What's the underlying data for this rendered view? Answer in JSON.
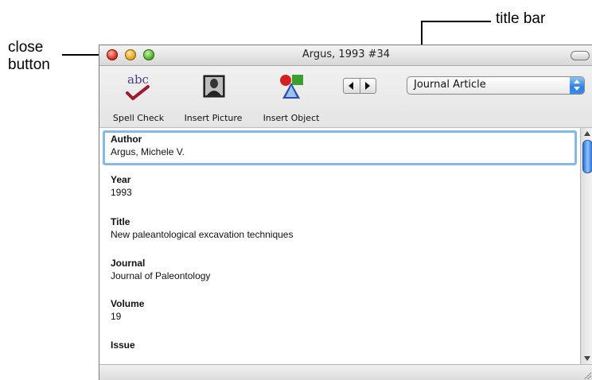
{
  "annotations": {
    "title_bar": "title bar",
    "close_button_line1": "close",
    "close_button_line2": "button"
  },
  "window": {
    "title": "Argus, 1993 #34"
  },
  "toolbar": {
    "spell_check_label": "Spell Check",
    "spell_check_icon_text": "abc",
    "insert_picture_label": "Insert Picture",
    "insert_object_label": "Insert Object",
    "reference_type": "Journal Article"
  },
  "fields": [
    {
      "label": "Author",
      "value": "Argus, Michele V."
    },
    {
      "label": "Year",
      "value": "1993"
    },
    {
      "label": "Title",
      "value": "New paleantological excavation techniques"
    },
    {
      "label": "Journal",
      "value": "Journal of Paleontology"
    },
    {
      "label": "Volume",
      "value": "19"
    },
    {
      "label": "Issue",
      "value": ""
    }
  ],
  "icons": {
    "close": "close-icon",
    "minimize": "minimize-icon",
    "zoom": "zoom-icon",
    "spell_check": "spell-check-icon",
    "insert_picture": "insert-picture-icon",
    "insert_object": "insert-object-icon"
  },
  "colors": {
    "close": "#d9291c",
    "minimize": "#e3a21b",
    "zoom": "#4eae2c",
    "focus_ring": "#8ab8e6",
    "select_button": "#2f7fe0"
  }
}
